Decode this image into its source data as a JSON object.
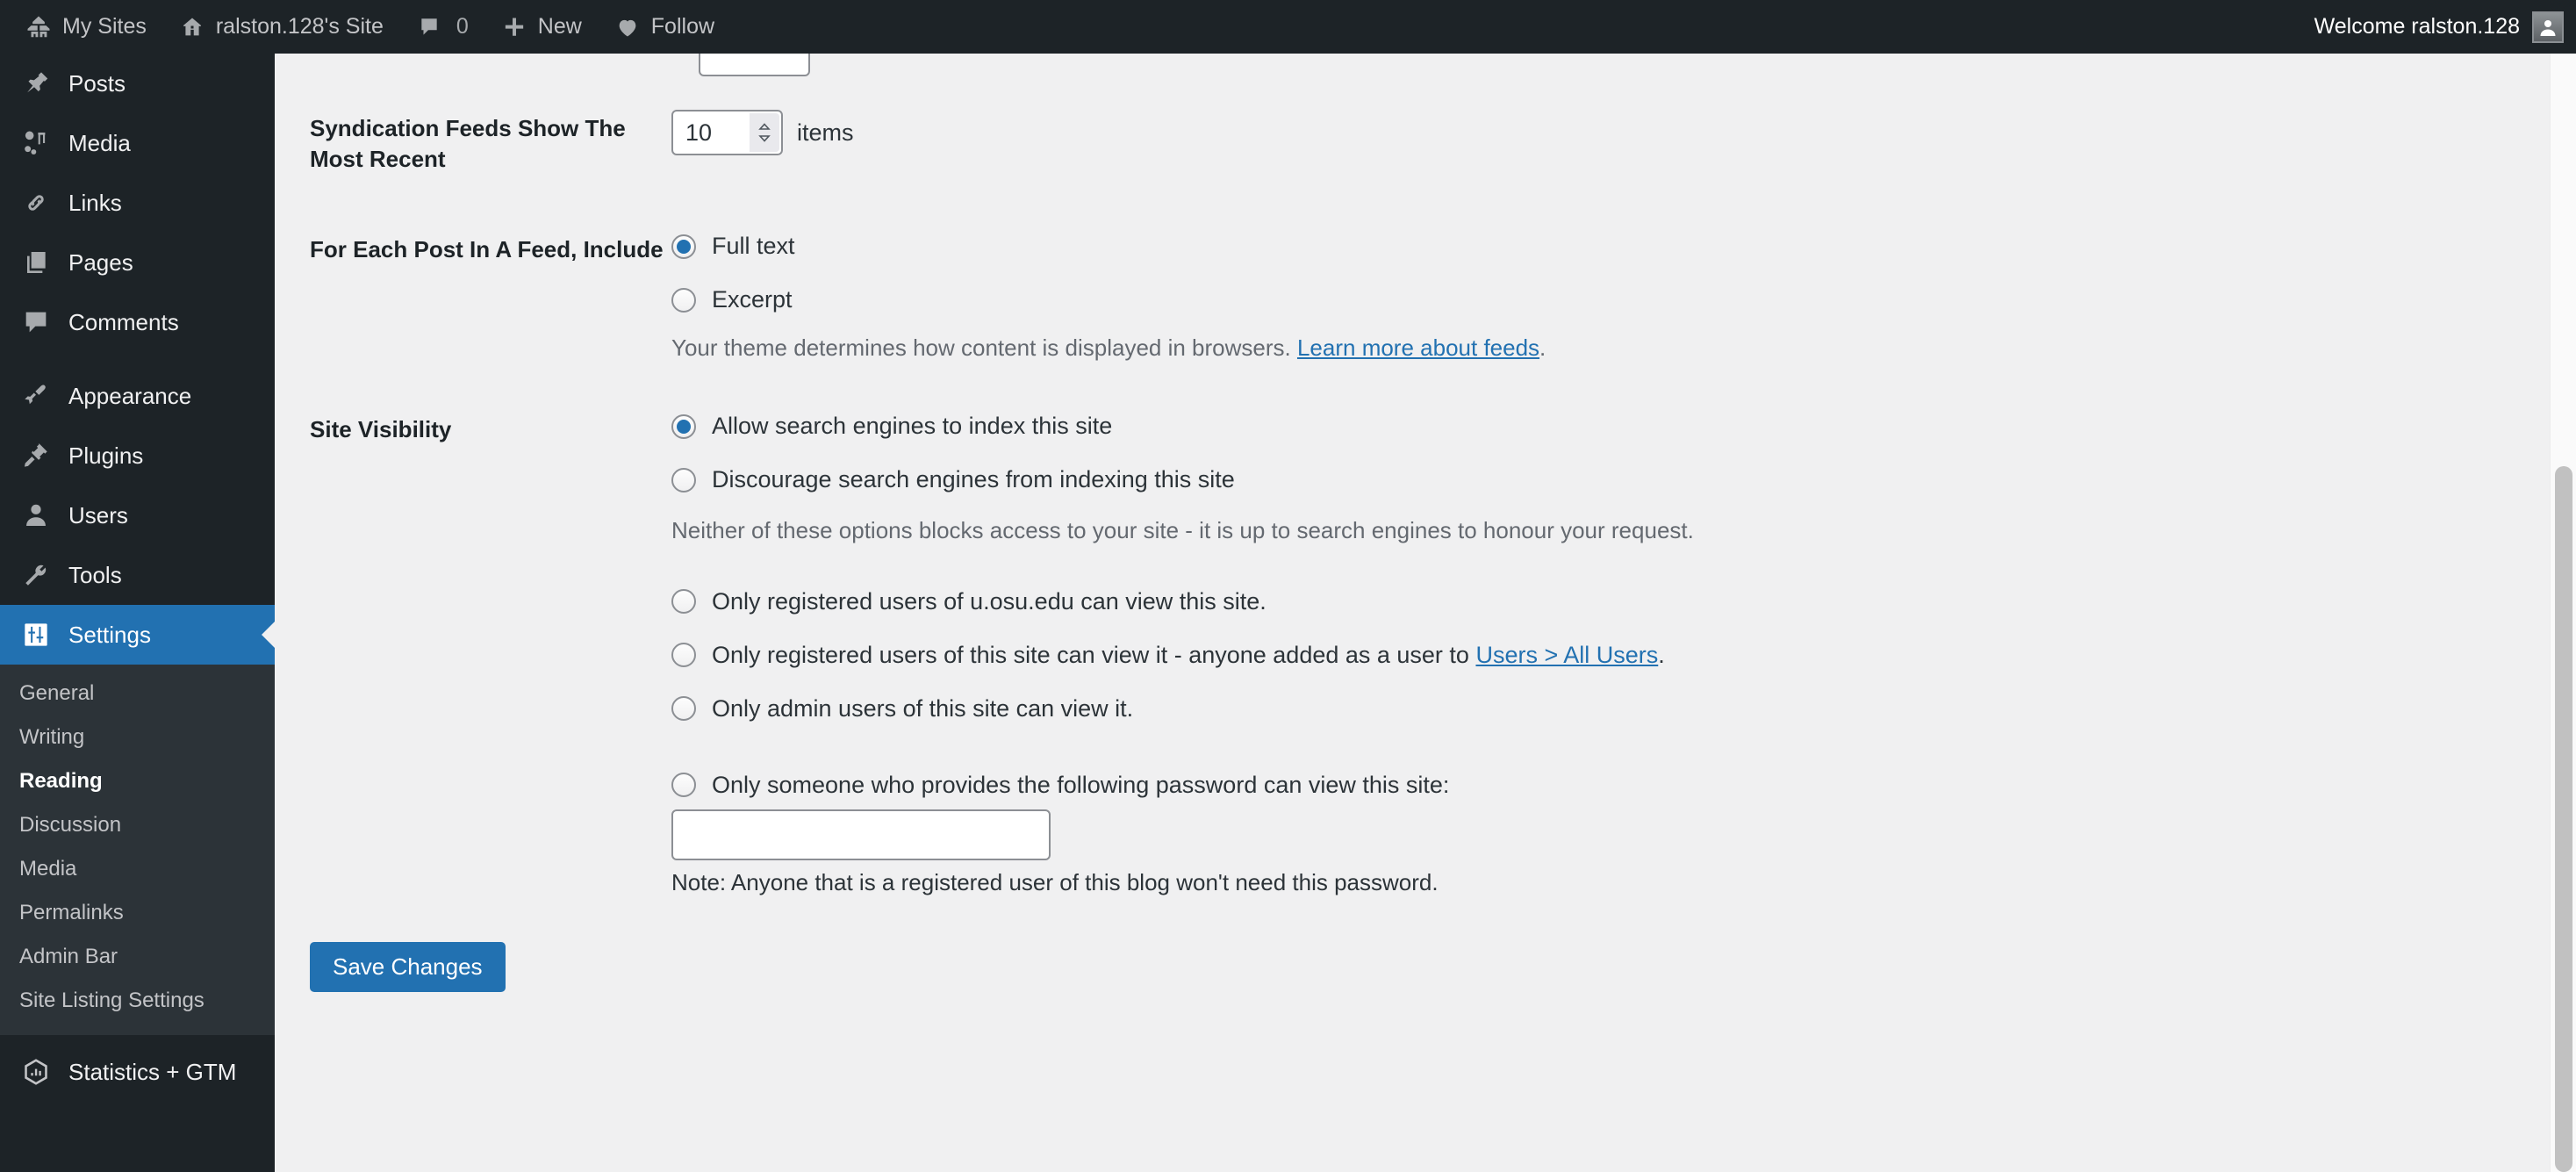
{
  "adminbar": {
    "left_items": [
      {
        "label": "My Sites",
        "icon": "wordpress-sites-icon"
      },
      {
        "label": "ralston.128's Site",
        "icon": "home-icon"
      },
      {
        "label": "0",
        "icon": "comment-bubble-icon"
      },
      {
        "label": "New",
        "icon": "plus-icon"
      },
      {
        "label": "Follow",
        "icon": "heart-icon"
      }
    ],
    "welcome": "Welcome ralston.128",
    "avatar_icon": "user-avatar-icon"
  },
  "sidebar": {
    "items": [
      {
        "label": "Posts",
        "icon": "pin-icon",
        "current": false
      },
      {
        "label": "Media",
        "icon": "media-icon",
        "current": false
      },
      {
        "label": "Links",
        "icon": "link-icon",
        "current": false
      },
      {
        "label": "Pages",
        "icon": "pages-icon",
        "current": false
      },
      {
        "label": "Comments",
        "icon": "comment-icon",
        "current": false
      },
      {
        "label": "Appearance",
        "icon": "paintbrush-icon",
        "current": false
      },
      {
        "label": "Plugins",
        "icon": "plug-icon",
        "current": false
      },
      {
        "label": "Users",
        "icon": "user-icon",
        "current": false
      },
      {
        "label": "Tools",
        "icon": "wrench-icon",
        "current": false
      },
      {
        "label": "Settings",
        "icon": "settings-sliders-icon",
        "current": true
      }
    ],
    "submenu": [
      {
        "label": "General",
        "current": false
      },
      {
        "label": "Writing",
        "current": false
      },
      {
        "label": "Reading",
        "current": true
      },
      {
        "label": "Discussion",
        "current": false
      },
      {
        "label": "Media",
        "current": false
      },
      {
        "label": "Permalinks",
        "current": false
      },
      {
        "label": "Admin Bar",
        "current": false
      },
      {
        "label": "Site Listing Settings",
        "current": false
      }
    ],
    "footer_item": {
      "label": "Statistics + GTM",
      "icon": "statistics-hexagon-icon"
    }
  },
  "main": {
    "syndication": {
      "label": "Syndication Feeds Show The Most Recent",
      "value": "10",
      "units": "items"
    },
    "feed_include": {
      "label": "For Each Post In A Feed, Include",
      "options": [
        {
          "label": "Full text",
          "checked": true
        },
        {
          "label": "Excerpt",
          "checked": false
        }
      ],
      "description_text": "Your theme determines how content is displayed in browsers. ",
      "description_link": "Learn more about feeds",
      "description_tail": "."
    },
    "site_visibility": {
      "label": "Site Visibility",
      "search_options": [
        {
          "label": "Allow search engines to index this site",
          "checked": true
        },
        {
          "label": "Discourage search engines from indexing this site",
          "checked": false
        }
      ],
      "search_note": "Neither of these options blocks access to your site - it is up to search engines to honour your request.",
      "access_options": [
        {
          "label": "Only registered users of u.osu.edu can view this site.",
          "checked": false
        },
        {
          "label_before": "Only registered users of this site can view it - anyone added as a user to ",
          "link": "Users > All Users",
          "label_after": ".",
          "checked": false
        },
        {
          "label": "Only admin users of this site can view it.",
          "checked": false
        }
      ],
      "password_option": {
        "label": "Only someone who provides the following password can view this site:",
        "checked": false
      },
      "password_value": "",
      "password_note": "Note: Anyone that is a registered user of this blog won't need this password."
    },
    "save_button": "Save Changes"
  },
  "colors": {
    "accent": "#2271b1",
    "sidebar_bg": "#1d2327",
    "submenu_bg": "#2c3338",
    "content_bg": "#f0f0f1"
  }
}
